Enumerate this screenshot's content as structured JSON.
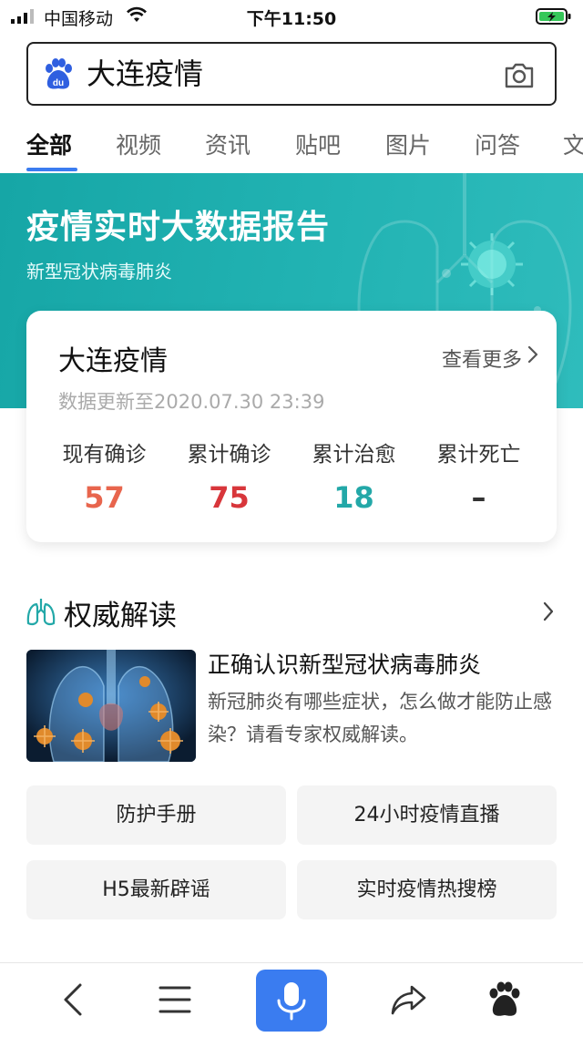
{
  "status_bar": {
    "carrier": "中国移动",
    "time": "下午11:50"
  },
  "search": {
    "query": "大连疫情",
    "left_icon": "baidu-paw-icon",
    "right_icon": "camera-icon"
  },
  "tabs": [
    {
      "label": "全部",
      "active": true
    },
    {
      "label": "视频",
      "active": false
    },
    {
      "label": "资讯",
      "active": false
    },
    {
      "label": "贴吧",
      "active": false
    },
    {
      "label": "图片",
      "active": false
    },
    {
      "label": "问答",
      "active": false
    },
    {
      "label": "文",
      "active": false
    }
  ],
  "banner": {
    "title": "疫情实时大数据报告",
    "subtitle": "新型冠状病毒肺炎"
  },
  "card": {
    "title": "大连疫情",
    "more_label": "查看更多",
    "updated": "数据更新至2020.07.30 23:39",
    "stats": [
      {
        "label": "现有确诊",
        "value": "57",
        "color": "#e8654d"
      },
      {
        "label": "累计确诊",
        "value": "75",
        "color": "#d8363b"
      },
      {
        "label": "累计治愈",
        "value": "18",
        "color": "#23a8a8"
      },
      {
        "label": "累计死亡",
        "value": "–",
        "color": "#333333"
      }
    ]
  },
  "authority": {
    "title": "权威解读",
    "icon": "lungs-icon",
    "article_title": "正确认识新型冠状病毒肺炎",
    "article_desc": "新冠肺炎有哪些症状，怎么做才能防止感染？请看专家权威解读。"
  },
  "quick_links": [
    "防护手册",
    "24小时疫情直播",
    "H5最新辟谣",
    "实时疫情热搜榜"
  ],
  "toolbar": {
    "items": [
      "back-icon",
      "menu-icon",
      "microphone-icon",
      "share-icon",
      "baidu-paw-icon"
    ]
  },
  "colors": {
    "accent": "#3a7cf0",
    "banner": "#1aa9a9"
  }
}
